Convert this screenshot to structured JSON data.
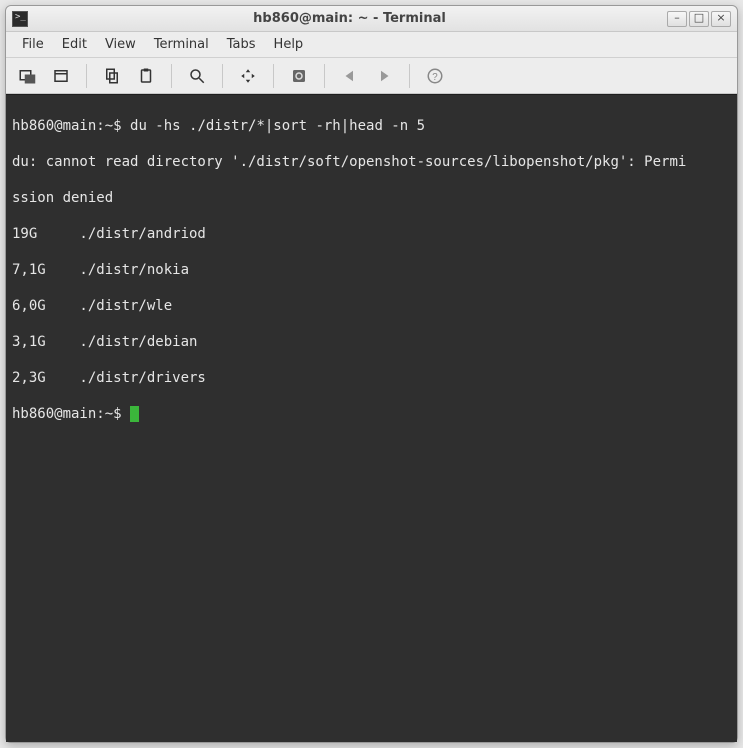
{
  "titlebar": {
    "title": "hb860@main: ~ - Terminal",
    "minimize": "–",
    "maximize": "□",
    "close": "×"
  },
  "menubar": {
    "items": [
      "File",
      "Edit",
      "View",
      "Terminal",
      "Tabs",
      "Help"
    ]
  },
  "toolbar": {
    "icons": [
      "new-tab-icon",
      "new-window-icon",
      "sep",
      "copy-icon",
      "paste-icon",
      "sep",
      "search-icon",
      "sep",
      "fullscreen-icon",
      "sep",
      "preferences-icon",
      "sep",
      "prev-icon",
      "next-icon",
      "sep",
      "help-icon"
    ]
  },
  "terminal": {
    "prompt1": "hb860@main:~$ ",
    "command": "du -hs ./distr/*|sort -rh|head -n 5",
    "error_line1": "du: cannot read directory './distr/soft/openshot-sources/libopenshot/pkg': Permi",
    "error_line2": "ssion denied",
    "rows": [
      "19G     ./distr/andriod",
      "7,1G    ./distr/nokia",
      "6,0G    ./distr/wle",
      "3,1G    ./distr/debian",
      "2,3G    ./distr/drivers"
    ],
    "prompt2": "hb860@main:~$ "
  }
}
